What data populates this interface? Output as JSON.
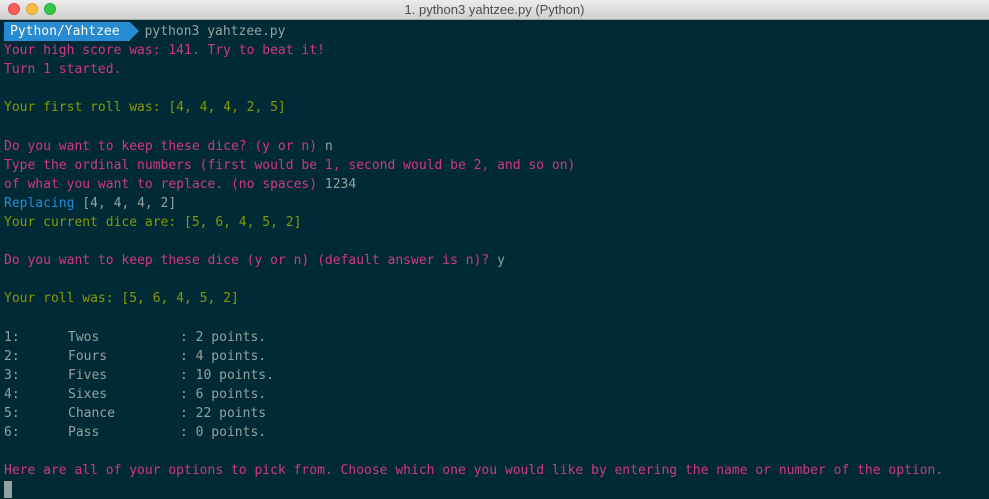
{
  "window": {
    "title": "1. python3 yahtzee.py (Python)"
  },
  "prompt": {
    "path": "Python/Yahtzee",
    "command": "python3 yahtzee.py"
  },
  "output": {
    "high_score": "Your high score was: 141. Try to beat it!",
    "turn_started": "Turn 1 started.",
    "first_roll": "Your first roll was: [4, 4, 4, 2, 5]",
    "keep_q1": "Do you want to keep these dice? (y or n) ",
    "keep_a1": "n",
    "ordinal_1": "Type the ordinal numbers (first would be 1, second would be 2, and so on)",
    "ordinal_2": "of what you want to replace. (no spaces) ",
    "ordinal_input": "1234",
    "replacing_label": "Replacing",
    "replacing_value": " [4, 4, 4, 2]",
    "current_dice": "Your current dice are: [5, 6, 4, 5, 2]",
    "keep_q2": "Do you want to keep these dice (y or n) (default answer is n)? ",
    "keep_a2": "y",
    "roll": "Your roll was: [5, 6, 4, 5, 2]",
    "options_prompt": "Here are all of your options to pick from. Choose which one you would like by entering the name or number of the option."
  },
  "options": [
    {
      "num": "1:",
      "name": "Twos",
      "points": ": 2 points."
    },
    {
      "num": "2:",
      "name": "Fours",
      "points": ": 4 points."
    },
    {
      "num": "3:",
      "name": "Fives",
      "points": ": 10 points."
    },
    {
      "num": "4:",
      "name": "Sixes",
      "points": ": 6 points."
    },
    {
      "num": "5:",
      "name": "Chance",
      "points": ": 22 points"
    },
    {
      "num": "6:",
      "name": "Pass",
      "points": ": 0 points."
    }
  ],
  "colors": {
    "background": "#002b36",
    "pink": "#d33682",
    "yellow": "#859900",
    "blue": "#268bd2",
    "text": "#93a1a1"
  }
}
